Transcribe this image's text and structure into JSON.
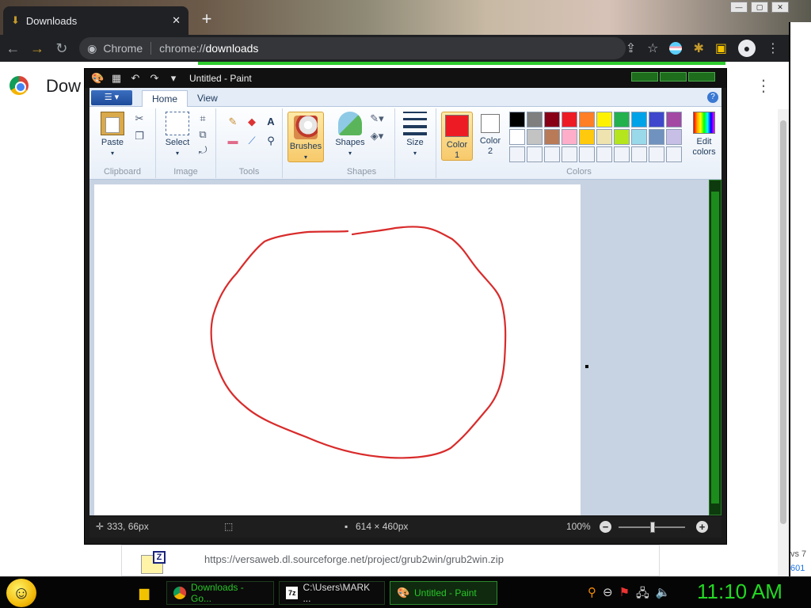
{
  "browser": {
    "tab_title": "Downloads",
    "new_tab": "+",
    "omnibox_label": "Chrome",
    "url_prefix": "chrome://",
    "url_host": "downloads",
    "page_title": "Dow",
    "download_url": "https://versaweb.dl.sourceforge.net/project/grub2win/grub2win.zip",
    "side_text_1": "vs 7",
    "side_text_2": "601"
  },
  "paint": {
    "window_title": "Untitled - Paint",
    "tabs": [
      {
        "label": "Home"
      },
      {
        "label": "View"
      }
    ],
    "groups": {
      "clipboard": "Clipboard",
      "image": "Image",
      "tools": "Tools",
      "shapes": "Shapes",
      "colors": "Colors"
    },
    "buttons": {
      "paste": "Paste",
      "select": "Select",
      "brushes": "Brushes",
      "shapes": "Shapes",
      "size": "Size",
      "color1_a": "Color",
      "color1_b": "1",
      "color2_a": "Color",
      "color2_b": "2",
      "edit_colors_a": "Edit",
      "edit_colors_b": "colors"
    },
    "color1": "#ed1c24",
    "color2": "#ffffff",
    "palette": [
      "#000000",
      "#7f7f7f",
      "#880015",
      "#ed1c24",
      "#ff7f27",
      "#fff200",
      "#22b14c",
      "#00a2e8",
      "#3f48cc",
      "#a349a4",
      "#ffffff",
      "#c3c3c3",
      "#b97a57",
      "#ffaec9",
      "#ffc90e",
      "#efe4b0",
      "#b5e61d",
      "#99d9ea",
      "#7092be",
      "#c8bfe7",
      "#f0f4fa",
      "#f0f4fa",
      "#f0f4fa",
      "#f0f4fa",
      "#f0f4fa",
      "#f0f4fa",
      "#f0f4fa",
      "#f0f4fa",
      "#f0f4fa",
      "#f0f4fa"
    ],
    "status": {
      "cursor_pos": "333, 66px",
      "image_size": "614 × 460px",
      "zoom": "100%",
      "zoom_minus": "−",
      "zoom_plus": "+"
    },
    "stroke_color": "#d92b2b"
  },
  "taskbar": {
    "items": [
      {
        "label": "Downloads - Go..."
      },
      {
        "label": "C:\\Users\\MARK ..."
      },
      {
        "label": "Untitled - Paint"
      }
    ],
    "clock": "11:10 AM"
  }
}
